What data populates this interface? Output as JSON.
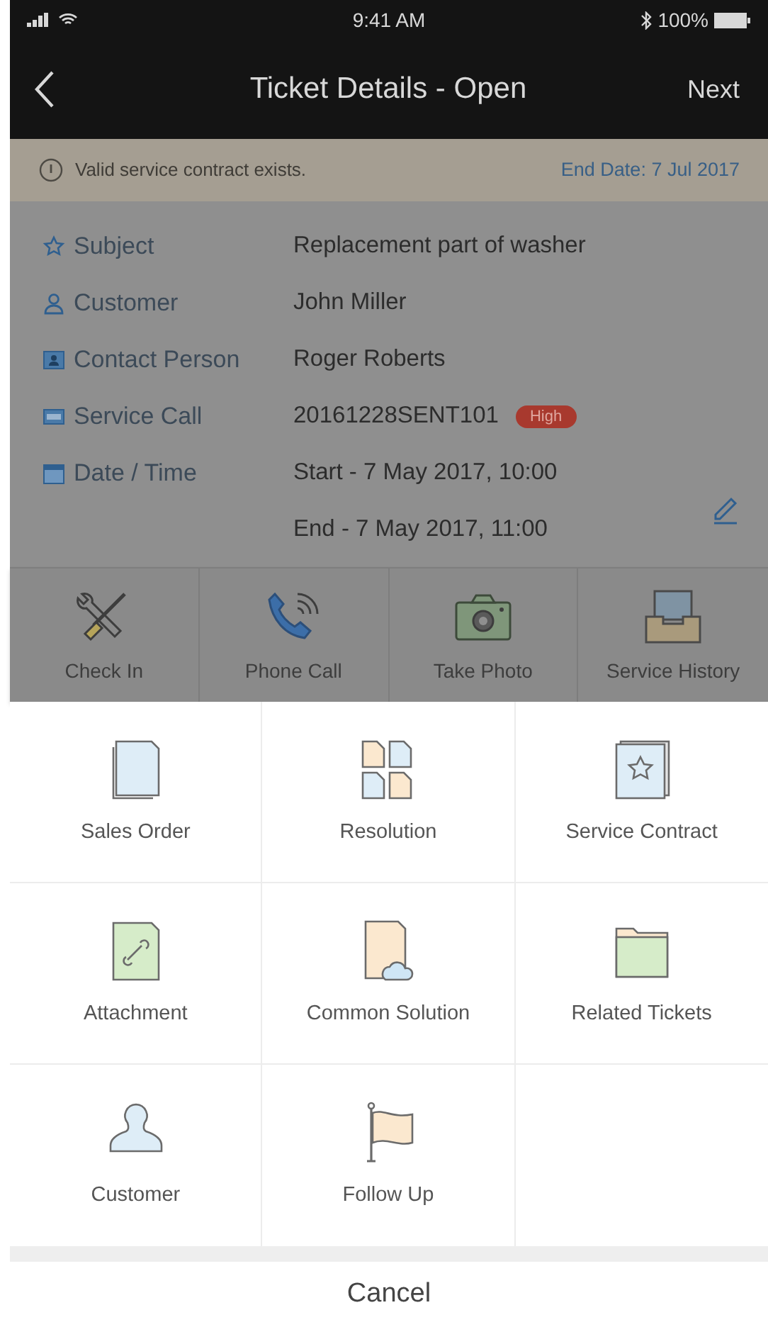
{
  "status_bar": {
    "time": "9:41 AM",
    "battery": "100%"
  },
  "nav": {
    "title": "Ticket Details - Open",
    "next": "Next"
  },
  "banner": {
    "message": "Valid service contract exists.",
    "end_date": "End Date: 7 Jul 2017"
  },
  "details": [
    {
      "kind": "star",
      "label": "Subject",
      "values": [
        "Replacement part of washer"
      ]
    },
    {
      "kind": "person",
      "label": "Customer",
      "values": [
        "John Miller"
      ]
    },
    {
      "kind": "contact",
      "label": "Contact Person",
      "values": [
        "Roger Roberts"
      ]
    },
    {
      "kind": "call",
      "label": "Service Call",
      "values": [
        "20161228SENT101"
      ],
      "badge": "High"
    },
    {
      "kind": "calendar",
      "label": "Date / Time",
      "values": [
        "Start - 7 May 2017, 10:00",
        "End - 7 May 2017, 11:00"
      ],
      "editable": true
    }
  ],
  "quick_actions": [
    {
      "kind": "tools",
      "label": "Check In"
    },
    {
      "kind": "phone",
      "label": "Phone Call"
    },
    {
      "kind": "camera",
      "label": "Take Photo"
    },
    {
      "kind": "tray",
      "label": "Service History"
    }
  ],
  "menu_items": [
    {
      "kind": "document",
      "label": "Sales Order"
    },
    {
      "kind": "grid",
      "label": "Resolution"
    },
    {
      "kind": "contract",
      "label": "Service Contract"
    },
    {
      "kind": "attachment",
      "label": "Attachment"
    },
    {
      "kind": "cloud",
      "label": "Common Solution"
    },
    {
      "kind": "folder",
      "label": "Related Tickets"
    },
    {
      "kind": "person",
      "label": "Customer"
    },
    {
      "kind": "flag",
      "label": "Follow Up"
    }
  ],
  "cancel": "Cancel"
}
